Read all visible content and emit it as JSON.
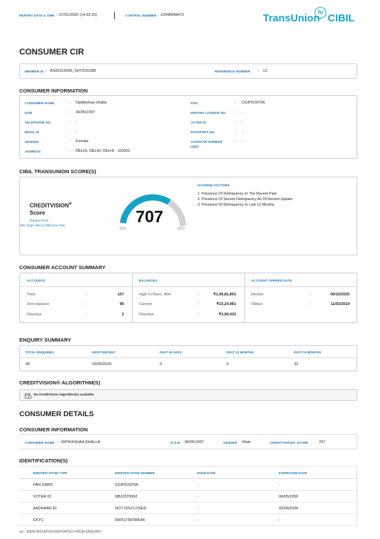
{
  "header": {
    "report_date_label": "REPORT DATE & TIME",
    "report_date_value": "07/01/2026 (14:03:25)",
    "control_label": "CONTROL NUMBER",
    "control_value": "10348948472",
    "logo_text_1": "TransUnion",
    "logo_text_2": "CIBIL",
    "logo_mark": "tu"
  },
  "title": "CONSUMER CIR",
  "member": {
    "member_id_label": "MEMBER ID",
    "member_id_value": "BS00115009_SHYD20188",
    "reference_label": "REFERENCE NUMBER",
    "reference_value": "12"
  },
  "consumer_info": {
    "title": "CONSUMER INFORMATION",
    "left": [
      {
        "label": "CONSUMER NAME",
        "value": "Dipikkshaa Dhalla"
      },
      {
        "label": "DOB",
        "value": "30/05/1997"
      },
      {
        "label": "TELEPHONE NO.",
        "value": "-"
      },
      {
        "label": "EMAIL ID",
        "value": "-"
      },
      {
        "label": "GENDER",
        "value": "Female"
      },
      {
        "label": "ADDRESS",
        "value": "DELHI, DELHI, DELHI - 110001"
      }
    ],
    "right": [
      {
        "label": "PAN",
        "value": "CGIPD2970A"
      },
      {
        "label": "DRIVING LICENCE NO.",
        "value": "-"
      },
      {
        "label": "VOTER ID",
        "value": "-"
      },
      {
        "label": "PASSPORT NO.",
        "value": "-"
      },
      {
        "label": "AADHAAR NUMBER (UID)",
        "value": "-"
      }
    ]
  },
  "score_section": {
    "title": "CIBIL TRANSUNION SCORE(S)",
    "cv_title": "CREDITVISION",
    "cv_reg": "®",
    "cv_sub": "Score",
    "range_text_1": "Ranges from",
    "range_text_2": "300 (high risk) to 900 (low risk)",
    "score": "707",
    "score_value": 707,
    "min": "300",
    "max": "900",
    "factors_title": "SCORING FACTORS",
    "factors": [
      "1. Presence Of Delinquency In The Recent Past",
      "2. Presence Of Severe Delinquency As Of Recent Update",
      "3. Presence Of Delinquency In Last 12 Months"
    ],
    "accent": "#14a3c7"
  },
  "account_summary": {
    "title": "CONSUMER ACCOUNT SUMMARY",
    "accounts": {
      "header": "ACCOUNTS",
      "rows": [
        {
          "label": "Total",
          "value": "107"
        },
        {
          "label": "Zero balance",
          "value": "96"
        },
        {
          "label": "Overdue",
          "value": "2"
        }
      ]
    },
    "balances": {
      "header": "BALANCES",
      "rows": [
        {
          "label": "High Cr/Sanc. Amt",
          "value": "₹1,08,81,801"
        },
        {
          "label": "Current",
          "value": "₹15,24,961"
        },
        {
          "label": "Overdue",
          "value": "₹3,90,433"
        }
      ]
    },
    "opened": {
      "header": "ACCOUNT OPENED DATE",
      "rows": [
        {
          "label": "Recent",
          "value": "09/12/2025"
        },
        {
          "label": "Oldest",
          "value": "11/03/2019"
        }
      ]
    }
  },
  "enquiry": {
    "title": "ENQUIRY SUMMARY",
    "headers": [
      "TOTAL ENQUIRIES",
      "MOST RECENT",
      "PAST 30 DAYS",
      "PAST 12 MONTHS",
      "PAST 24 MONTHS"
    ],
    "values": [
      "49",
      "03/05/2025",
      "0",
      "6",
      "32"
    ]
  },
  "algorithm": {
    "title": "CREDITVISION® ALGORITHM(S)",
    "message": "No CreditVision Algorithm(s) available."
  },
  "consumer_details": {
    "title": "CONSUMER DETAILS",
    "info_title": "CONSUMER INFORMATION",
    "name_label": "CONSUMER NAME",
    "name_value": "DIPIKKSHAA DHALLA",
    "dob_label": "D.O.B",
    "dob_value": "30/05/1997",
    "gender_label": "GENDER",
    "gender_value": "Male",
    "score_label": "CREDITVISION® SCORE",
    "score_value": "707"
  },
  "identification": {
    "title": "IDENTIFICATION(S)",
    "headers": [
      "IDENTIFICATION TYPE",
      "IDENTIFICATION NUMBER",
      "ISSUE DATE",
      "EXPIRATION DATE"
    ],
    "rows": [
      [
        "PAN CARD",
        "CGIPD2970A",
        "-",
        "-"
      ],
      [
        "VOTER ID",
        "NBJ2370062",
        "-",
        "06/05/2050"
      ],
      [
        "AADHAAR ID",
        "NOT DISCLOSED",
        "-",
        "02/04/2034"
      ],
      [
        "CKYC",
        "50051758789646",
        "-",
        "-"
      ]
    ],
    "footnote": "(e) - IDENTIFICATION REPORTED FROM ENQUIRY"
  }
}
